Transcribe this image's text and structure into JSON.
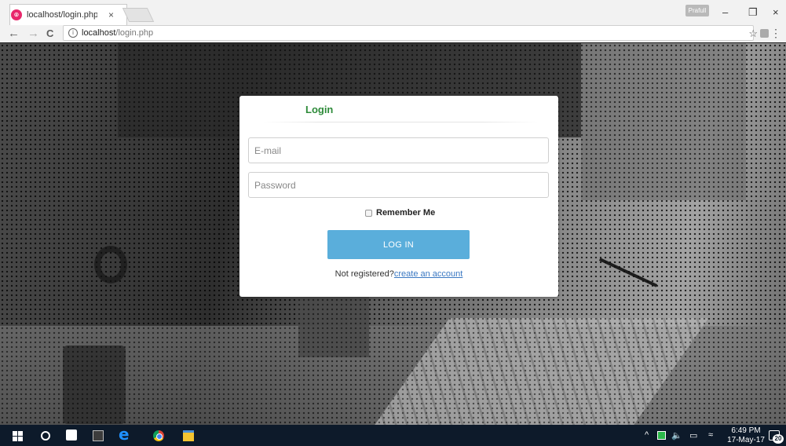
{
  "browser": {
    "tab_title": "localhost/login.php",
    "tab_close": "×",
    "profile_label": "Prafull",
    "url_host": "localhost",
    "url_path": "/login.php",
    "minimize": "–",
    "restore": "❐",
    "close": "×",
    "back": "←",
    "forward": "→",
    "reload": "C",
    "info": "i",
    "star": "☆",
    "menu": "⋮"
  },
  "login": {
    "title": "Login",
    "email_placeholder": "E-mail",
    "password_placeholder": "Password",
    "remember_label": "Remember Me",
    "button_label": "LOG IN",
    "register_text": "Not registered?",
    "register_link": "create an account"
  },
  "taskbar": {
    "time": "6:49 PM",
    "date": "17-May-17",
    "notification_count": "20",
    "tray_up": "^",
    "tray_volume": "🔈",
    "tray_net": "▭",
    "tray_wifi": "≈",
    "edge_glyph": "e"
  },
  "colors": {
    "login_title": "#2e8b3a",
    "login_button": "#5aaedb",
    "link": "#3a78c2",
    "taskbar": "#0d1a2a"
  }
}
